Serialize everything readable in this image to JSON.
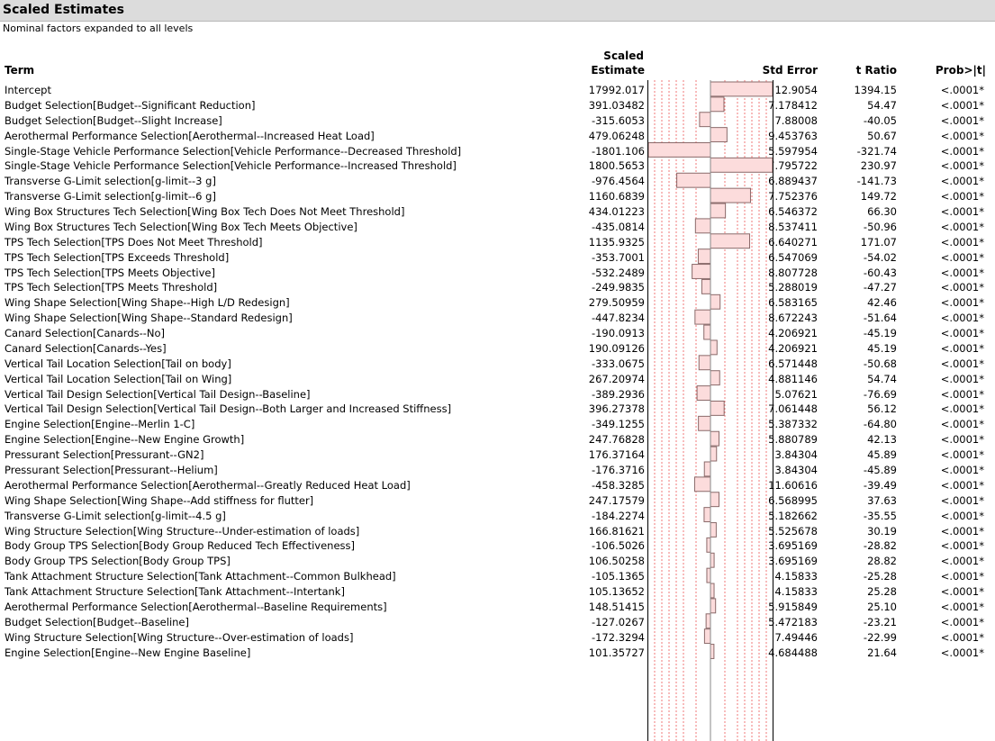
{
  "report": {
    "title": "Scaled Estimates",
    "subtitle": "Nominal factors expanded to all levels",
    "columns": {
      "term": "Term",
      "scaled_top": "Scaled",
      "scaled_bottom": "Estimate",
      "std_error": "Std Error",
      "t_ratio": "t Ratio",
      "prob": "Prob>|t|"
    },
    "rows": [
      {
        "term": "Intercept",
        "estimate": "17992.017",
        "value": 17992.017,
        "std_error": "12.9054",
        "t_ratio": "1394.15",
        "prob": "<.0001*"
      },
      {
        "term": "Budget Selection[Budget--Significant Reduction]",
        "estimate": "391.03482",
        "value": 391.03482,
        "std_error": "7.178412",
        "t_ratio": "54.47",
        "prob": "<.0001*"
      },
      {
        "term": "Budget Selection[Budget--Slight Increase]",
        "estimate": "-315.6053",
        "value": -315.6053,
        "std_error": "7.88008",
        "t_ratio": "-40.05",
        "prob": "<.0001*"
      },
      {
        "term": "Aerothermal Performance Selection[Aerothermal--Increased Heat Load]",
        "estimate": "479.06248",
        "value": 479.06248,
        "std_error": "9.453763",
        "t_ratio": "50.67",
        "prob": "<.0001*"
      },
      {
        "term": "Single-Stage Vehicle Performance Selection[Vehicle Performance--Decreased Threshold]",
        "estimate": "-1801.106",
        "value": -1801.106,
        "std_error": "5.597954",
        "t_ratio": "-321.74",
        "prob": "<.0001*"
      },
      {
        "term": "Single-Stage Vehicle Performance Selection[Vehicle Performance--Increased Threshold]",
        "estimate": "1800.5653",
        "value": 1800.5653,
        "std_error": "7.795722",
        "t_ratio": "230.97",
        "prob": "<.0001*"
      },
      {
        "term": "Transverse G-Limit selection[g-limit--3 g]",
        "estimate": "-976.4564",
        "value": -976.4564,
        "std_error": "6.889437",
        "t_ratio": "-141.73",
        "prob": "<.0001*"
      },
      {
        "term": "Transverse G-Limit selection[g-limit--6 g]",
        "estimate": "1160.6839",
        "value": 1160.6839,
        "std_error": "7.752376",
        "t_ratio": "149.72",
        "prob": "<.0001*"
      },
      {
        "term": "Wing Box Structures Tech Selection[Wing Box Tech Does Not Meet Threshold]",
        "estimate": "434.01223",
        "value": 434.01223,
        "std_error": "6.546372",
        "t_ratio": "66.30",
        "prob": "<.0001*"
      },
      {
        "term": "Wing Box Structures Tech Selection[Wing Box Tech Meets Objective]",
        "estimate": "-435.0814",
        "value": -435.0814,
        "std_error": "8.537411",
        "t_ratio": "-50.96",
        "prob": "<.0001*"
      },
      {
        "term": "TPS Tech Selection[TPS Does Not Meet Threshold]",
        "estimate": "1135.9325",
        "value": 1135.9325,
        "std_error": "6.640271",
        "t_ratio": "171.07",
        "prob": "<.0001*"
      },
      {
        "term": "TPS Tech Selection[TPS Exceeds Threshold]",
        "estimate": "-353.7001",
        "value": -353.7001,
        "std_error": "6.547069",
        "t_ratio": "-54.02",
        "prob": "<.0001*"
      },
      {
        "term": "TPS Tech Selection[TPS Meets Objective]",
        "estimate": "-532.2489",
        "value": -532.2489,
        "std_error": "8.807728",
        "t_ratio": "-60.43",
        "prob": "<.0001*"
      },
      {
        "term": "TPS Tech Selection[TPS Meets Threshold]",
        "estimate": "-249.9835",
        "value": -249.9835,
        "std_error": "5.288019",
        "t_ratio": "-47.27",
        "prob": "<.0001*"
      },
      {
        "term": "Wing Shape Selection[Wing Shape--High L/D Redesign]",
        "estimate": "279.50959",
        "value": 279.50959,
        "std_error": "6.583165",
        "t_ratio": "42.46",
        "prob": "<.0001*"
      },
      {
        "term": "Wing Shape Selection[Wing Shape--Standard Redesign]",
        "estimate": "-447.8234",
        "value": -447.8234,
        "std_error": "8.672243",
        "t_ratio": "-51.64",
        "prob": "<.0001*"
      },
      {
        "term": "Canard Selection[Canards--No]",
        "estimate": "-190.0913",
        "value": -190.0913,
        "std_error": "4.206921",
        "t_ratio": "-45.19",
        "prob": "<.0001*"
      },
      {
        "term": "Canard Selection[Canards--Yes]",
        "estimate": "190.09126",
        "value": 190.09126,
        "std_error": "4.206921",
        "t_ratio": "45.19",
        "prob": "<.0001*"
      },
      {
        "term": "Vertical Tail Location Selection[Tail on body]",
        "estimate": "-333.0675",
        "value": -333.0675,
        "std_error": "6.571448",
        "t_ratio": "-50.68",
        "prob": "<.0001*"
      },
      {
        "term": "Vertical Tail Location Selection[Tail on Wing]",
        "estimate": "267.20974",
        "value": 267.20974,
        "std_error": "4.881146",
        "t_ratio": "54.74",
        "prob": "<.0001*"
      },
      {
        "term": "Vertical Tail Design Selection[Vertical Tail Design--Baseline]",
        "estimate": "-389.2936",
        "value": -389.2936,
        "std_error": "5.07621",
        "t_ratio": "-76.69",
        "prob": "<.0001*"
      },
      {
        "term": "Vertical Tail Design Selection[Vertical Tail Design--Both Larger and Increased Stiffness]",
        "estimate": "396.27378",
        "value": 396.27378,
        "std_error": "7.061448",
        "t_ratio": "56.12",
        "prob": "<.0001*"
      },
      {
        "term": "Engine Selection[Engine--Merlin 1-C]",
        "estimate": "-349.1255",
        "value": -349.1255,
        "std_error": "5.387332",
        "t_ratio": "-64.80",
        "prob": "<.0001*"
      },
      {
        "term": "Engine Selection[Engine--New Engine Growth]",
        "estimate": "247.76828",
        "value": 247.76828,
        "std_error": "5.880789",
        "t_ratio": "42.13",
        "prob": "<.0001*"
      },
      {
        "term": "Pressurant Selection[Pressurant--GN2]",
        "estimate": "176.37164",
        "value": 176.37164,
        "std_error": "3.84304",
        "t_ratio": "45.89",
        "prob": "<.0001*"
      },
      {
        "term": "Pressurant Selection[Pressurant--Helium]",
        "estimate": "-176.3716",
        "value": -176.3716,
        "std_error": "3.84304",
        "t_ratio": "-45.89",
        "prob": "<.0001*"
      },
      {
        "term": "Aerothermal Performance Selection[Aerothermal--Greatly Reduced Heat Load]",
        "estimate": "-458.3285",
        "value": -458.3285,
        "std_error": "11.60616",
        "t_ratio": "-39.49",
        "prob": "<.0001*"
      },
      {
        "term": "Wing Shape Selection[Wing Shape--Add stiffness for flutter]",
        "estimate": "247.17579",
        "value": 247.17579,
        "std_error": "6.568995",
        "t_ratio": "37.63",
        "prob": "<.0001*"
      },
      {
        "term": "Transverse G-Limit selection[g-limit--4.5 g]",
        "estimate": "-184.2274",
        "value": -184.2274,
        "std_error": "5.182662",
        "t_ratio": "-35.55",
        "prob": "<.0001*"
      },
      {
        "term": "Wing Structure Selection[Wing Structure--Under-estimation of loads]",
        "estimate": "166.81621",
        "value": 166.81621,
        "std_error": "5.525678",
        "t_ratio": "30.19",
        "prob": "<.0001*"
      },
      {
        "term": "Body Group TPS Selection[Body Group Reduced Tech Effectiveness]",
        "estimate": "-106.5026",
        "value": -106.5026,
        "std_error": "3.695169",
        "t_ratio": "-28.82",
        "prob": "<.0001*"
      },
      {
        "term": "Body Group TPS Selection[Body Group TPS]",
        "estimate": "106.50258",
        "value": 106.50258,
        "std_error": "3.695169",
        "t_ratio": "28.82",
        "prob": "<.0001*"
      },
      {
        "term": "Tank Attachment Structure Selection[Tank Attachment--Common Bulkhead]",
        "estimate": "-105.1365",
        "value": -105.1365,
        "std_error": "4.15833",
        "t_ratio": "-25.28",
        "prob": "<.0001*"
      },
      {
        "term": "Tank Attachment Structure Selection[Tank Attachment--Intertank]",
        "estimate": "105.13652",
        "value": 105.13652,
        "std_error": "4.15833",
        "t_ratio": "25.28",
        "prob": "<.0001*"
      },
      {
        "term": "Aerothermal Performance Selection[Aerothermal--Baseline Requirements]",
        "estimate": "148.51415",
        "value": 148.51415,
        "std_error": "5.915849",
        "t_ratio": "25.10",
        "prob": "<.0001*"
      },
      {
        "term": "Budget Selection[Budget--Baseline]",
        "estimate": "-127.0267",
        "value": -127.0267,
        "std_error": "5.472183",
        "t_ratio": "-23.21",
        "prob": "<.0001*"
      },
      {
        "term": "Wing Structure Selection[Wing Structure--Over-estimation of loads]",
        "estimate": "-172.3294",
        "value": -172.3294,
        "std_error": "7.49446",
        "t_ratio": "-22.99",
        "prob": "<.0001*"
      },
      {
        "term": "Engine Selection[Engine--New Engine Baseline]",
        "estimate": "101.35727",
        "value": 101.35727,
        "std_error": "4.684488",
        "t_ratio": "21.64",
        "prob": "<.0001*"
      }
    ]
  },
  "colors": {
    "bar_fill": "#fcdcdc",
    "bar_stroke": "#8a6a6a",
    "gridline": "#f27a7a",
    "title_bar": "#dcdcdc"
  }
}
